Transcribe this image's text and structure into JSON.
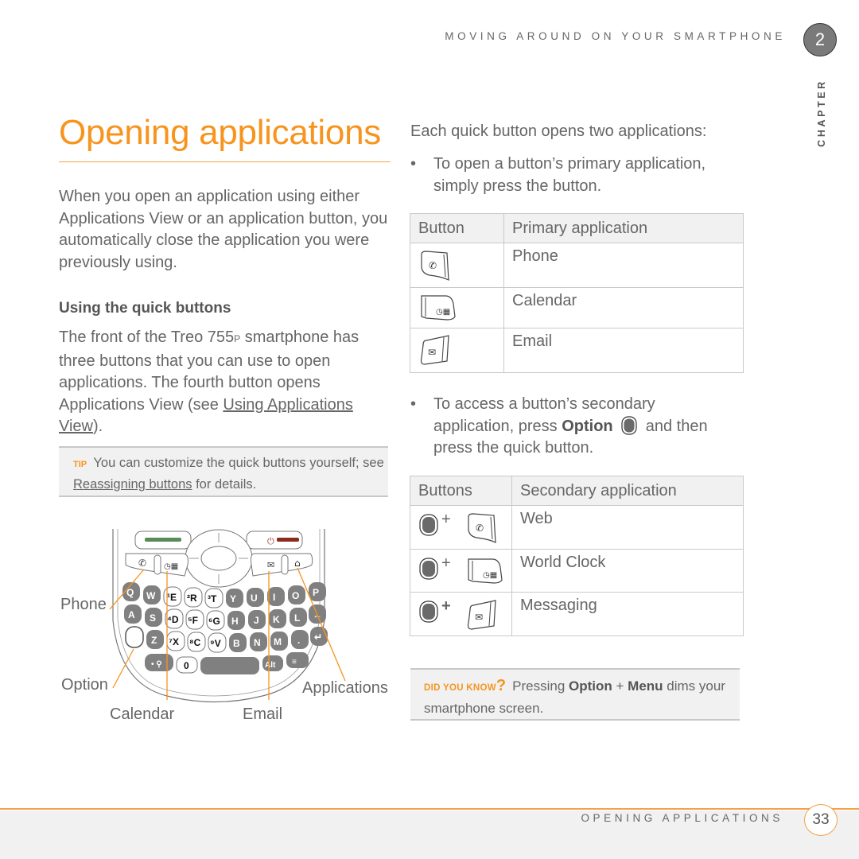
{
  "header": {
    "running_title": "MOVING AROUND ON YOUR SMARTPHONE",
    "chapter_number": "2",
    "chapter_label": "CHAPTER"
  },
  "left": {
    "title": "Opening applications",
    "intro": "When you open an application using either Applications View or an application button, you automatically close the application you were previously using.",
    "subhead": "Using the quick buttons",
    "front_part1": "The front of the Treo 755",
    "front_model_suffix": "P",
    "front_part2": " smartphone has three buttons that you can use to open applications. The fourth button opens Applications View (see ",
    "front_link": "Using Applications View",
    "front_part3": ").",
    "tip": {
      "label": "TIP",
      "text1": "You can customize the quick buttons yourself; see ",
      "link": "Reassigning buttons",
      "text2": " for details."
    },
    "figure_labels": {
      "phone": "Phone",
      "option": "Option",
      "calendar": "Calendar",
      "email": "Email",
      "applications": "Applications"
    }
  },
  "right": {
    "intro": "Each quick button opens two applications:",
    "bullet1": "To open a button’s primary application, simply press the button.",
    "primary_table": {
      "headers": [
        "Button",
        "Primary application"
      ],
      "rows": [
        {
          "icon": "phone-button-icon",
          "app": "Phone"
        },
        {
          "icon": "calendar-button-icon",
          "app": "Calendar"
        },
        {
          "icon": "email-button-icon",
          "app": "Email"
        }
      ]
    },
    "bullet2_part1": "To access a button’s secondary application, press ",
    "bullet2_bold": "Option",
    "bullet2_part2": " and then press the quick button.",
    "secondary_table": {
      "headers": [
        "Buttons",
        "Secondary application"
      ],
      "plus": "+",
      "rows": [
        {
          "icon": "phone-button-icon",
          "app": "Web"
        },
        {
          "icon": "calendar-button-icon",
          "app": "World Clock"
        },
        {
          "icon": "email-button-icon",
          "app": "Messaging"
        }
      ]
    },
    "did_you_know": {
      "label": "DID YOU KNOW",
      "question_mark": "?",
      "text1": "Pressing ",
      "bold1": "Option",
      "text2": " + ",
      "bold2": "Menu",
      "text3": " dims your smartphone screen."
    }
  },
  "footer": {
    "section_title": "OPENING APPLICATIONS",
    "page_number": "33"
  },
  "colors": {
    "accent_orange": "#f7941e",
    "body_text": "#666666",
    "box_background": "#f1f1f1"
  }
}
